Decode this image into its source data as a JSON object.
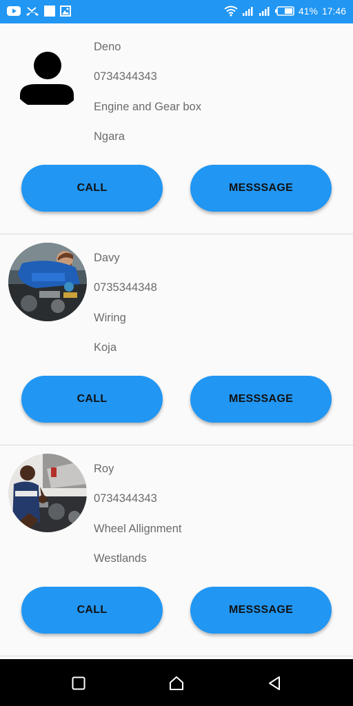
{
  "status_bar": {
    "left_icons": [
      "youtube-icon",
      "missed-call-icon",
      "square-notification-icon",
      "gallery-icon"
    ],
    "right_icons": [
      "wifi-icon",
      "signal-icon",
      "signal-icon",
      "battery-icon"
    ],
    "battery_percent": "41%",
    "time": "17:46",
    "color": "#2196f3"
  },
  "mechanics": [
    {
      "name": "Deno",
      "phone": "0734344343",
      "specialty": "Engine and Gear box",
      "location": "Ngara",
      "avatar": "default-person-icon",
      "call_label": "CALL",
      "message_label": "MESSSAGE"
    },
    {
      "name": "Davy",
      "phone": "0735344348",
      "specialty": "Wiring",
      "location": "Koja",
      "avatar": "mechanic-photo",
      "call_label": "CALL",
      "message_label": "MESSSAGE"
    },
    {
      "name": "Roy",
      "phone": "0734344343",
      "specialty": "Wheel Allignment",
      "location": "Westlands",
      "avatar": "mechanic-photo",
      "call_label": "CALL",
      "message_label": "MESSSAGE"
    }
  ],
  "nav_bar": {
    "buttons": [
      "recents-square-icon",
      "home-icon",
      "back-triangle-icon"
    ]
  },
  "colors": {
    "accent": "#2196f3",
    "text_secondary": "#6b6b6b",
    "background": "#fafafa"
  }
}
